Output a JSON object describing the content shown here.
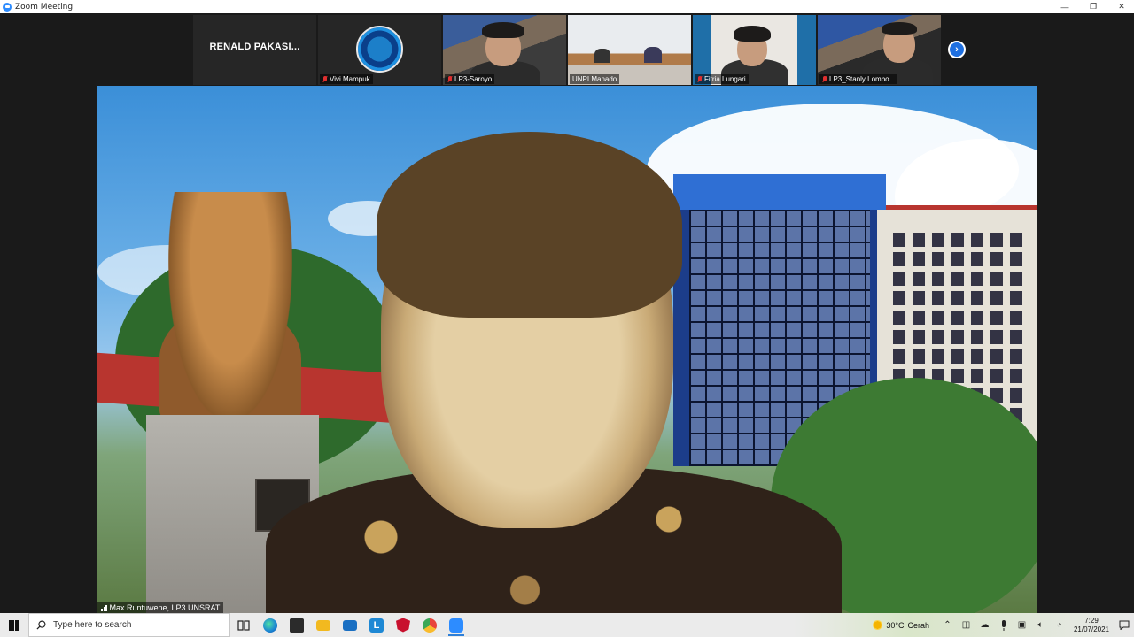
{
  "window": {
    "title": "Zoom Meeting",
    "controls": {
      "minimize": "—",
      "maximize": "❐",
      "close": "✕"
    }
  },
  "gallery": {
    "tiles": [
      {
        "id": "renald",
        "name": "RENALD PAKASI...",
        "type": "name-only"
      },
      {
        "id": "vivi",
        "name": "Vivi Mampuk",
        "muted": true,
        "type": "logo"
      },
      {
        "id": "saroyo",
        "name": "LP3-Saroyo",
        "muted": true,
        "type": "video"
      },
      {
        "id": "unpi",
        "name": "UNPI Manado",
        "muted": false,
        "type": "video"
      },
      {
        "id": "fitria",
        "name": "Fitria Lungari",
        "muted": true,
        "type": "video"
      },
      {
        "id": "stanly",
        "name": "LP3_Stanly Lombo...",
        "muted": true,
        "type": "video"
      }
    ],
    "next_glyph": "›"
  },
  "speaker": {
    "name": "Max Runtuwene, LP3 UNSRAT"
  },
  "taskbar": {
    "search_placeholder": "Type here to search",
    "apps": [
      {
        "name": "task-view",
        "color": "#333333"
      },
      {
        "name": "edge",
        "color": "#1b84d4"
      },
      {
        "name": "store",
        "color": "#2b2b2b"
      },
      {
        "name": "file-explorer",
        "color": "#f2b91f"
      },
      {
        "name": "mail",
        "color": "#1a6fc2"
      },
      {
        "name": "app-l",
        "color": "#1e88d4",
        "label": "L"
      },
      {
        "name": "mcafee",
        "color": "#c8102e"
      },
      {
        "name": "chrome",
        "color": "#e8453c"
      },
      {
        "name": "zoom",
        "color": "#2d8cff",
        "active": true
      }
    ],
    "weather": {
      "temp": "30°C",
      "condition": "Cerah"
    },
    "clock": {
      "time": "7:29",
      "date": "21/07/2021"
    }
  }
}
